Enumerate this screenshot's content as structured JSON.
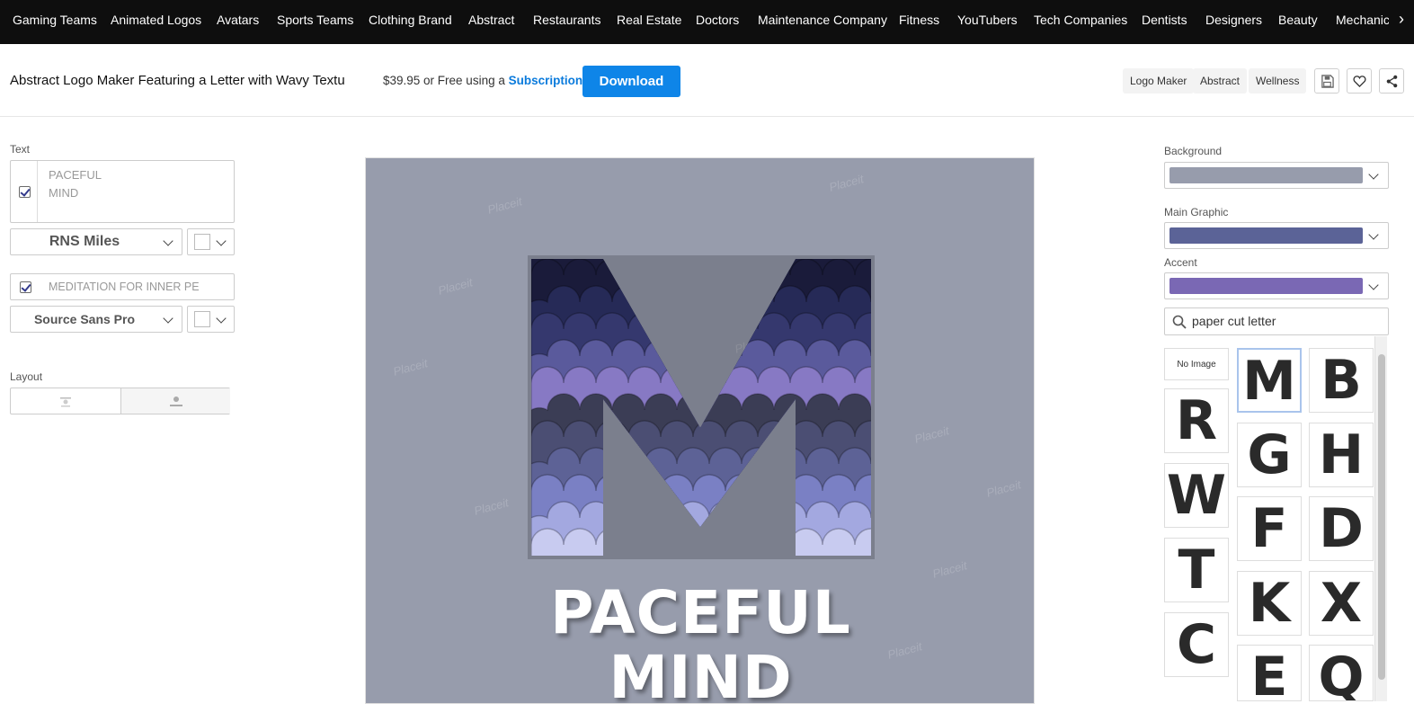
{
  "nav": {
    "categories": [
      "Gaming Teams",
      "Animated Logos",
      "Avatars",
      "Sports Teams",
      "Clothing Brand",
      "Abstract",
      "Restaurants",
      "Real Estate",
      "Doctors",
      "Maintenance Company",
      "Fitness",
      "YouTubers",
      "Tech Companies",
      "Dentists",
      "Designers",
      "Beauty",
      "Mechanic"
    ],
    "next_icon": "chevron-right-icon"
  },
  "header": {
    "title": "Abstract Logo Maker Featuring a Letter with Wavy Textu",
    "price": "$39.95",
    "price_suffix": " or Free using a ",
    "subscription_link": "Subscription",
    "download_label": "Download",
    "tags": [
      "Logo Maker",
      "Abstract",
      "Wellness"
    ],
    "icons": [
      "save-icon",
      "heart-icon",
      "share-icon"
    ]
  },
  "left_panel": {
    "text_label": "Text",
    "line1": "PACEFUL",
    "line2": "MIND",
    "font1": "RNS Miles",
    "tagline": "MEDITATION FOR INNER PE",
    "font2": "Source Sans Pro",
    "layout_label": "Layout"
  },
  "canvas": {
    "letter": "M",
    "logo_line1": "PACEFUL",
    "logo_line2": "MIND",
    "watermark": "Placeit",
    "background": "#979cac",
    "wave_colors": [
      "#1a1b3a",
      "#262a57",
      "#35386e",
      "#5a5a9c",
      "#8779c4",
      "#3b3d55",
      "#4b4e73",
      "#5d6296",
      "#7a80c4",
      "#a3a8e0",
      "#c8cbf0"
    ]
  },
  "right_panel": {
    "background_label": "Background",
    "background_color": "#979cac",
    "main_graphic_label": "Main Graphic",
    "main_graphic_color": "#5b6397",
    "accent_label": "Accent",
    "accent_color": "#7a68b4",
    "search_value": "paper cut letter",
    "no_image_label": "No Image",
    "thumbnails": [
      "M",
      "B",
      "R",
      "G",
      "H",
      "W",
      "F",
      "D",
      "T",
      "K",
      "X",
      "C",
      "E",
      "Q"
    ]
  }
}
